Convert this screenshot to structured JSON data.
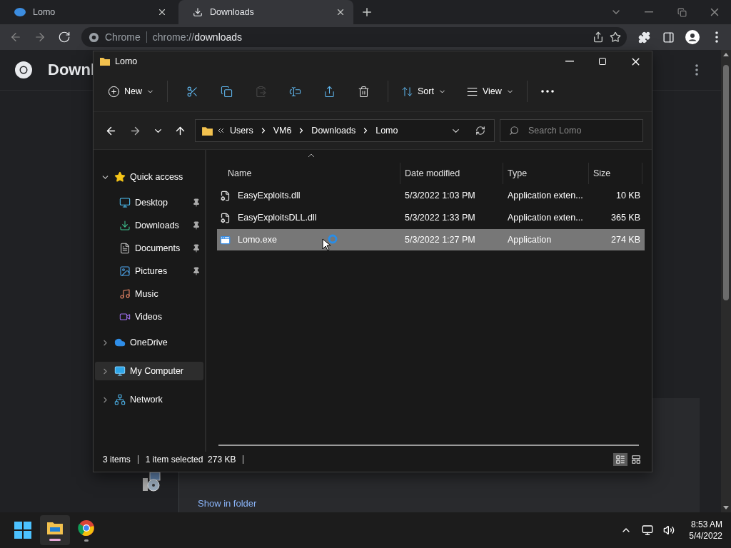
{
  "browser": {
    "tabs": [
      {
        "title": "Lomo",
        "kind": "site",
        "selected": false
      },
      {
        "title": "Downloads",
        "kind": "downloads",
        "selected": true
      }
    ],
    "omnibox": {
      "site": "Chrome",
      "url_prefix": "chrome://",
      "url_path": "downloads"
    }
  },
  "downloads_page": {
    "title": "Downl",
    "link": "Show in folder"
  },
  "explorer": {
    "title": "Lomo",
    "toolbar": {
      "new": "New",
      "sort": "Sort",
      "view": "View",
      "actions": [
        {
          "kind": "cut",
          "disabled": false
        },
        {
          "kind": "copy",
          "disabled": false
        },
        {
          "kind": "paste",
          "disabled": true
        },
        {
          "kind": "rename",
          "disabled": false
        },
        {
          "kind": "share",
          "disabled": false
        },
        {
          "kind": "delete",
          "disabled": false
        }
      ]
    },
    "breadcrumb": [
      "Users",
      "VM6",
      "Downloads",
      "Lomo"
    ],
    "search": {
      "placeholder": "Search Lomo"
    },
    "sidebar": [
      {
        "label": "Quick access",
        "kind": "star",
        "expanded": true,
        "selected": false,
        "children": [
          {
            "label": "Desktop",
            "kind": "desktop",
            "pinned": true,
            "selected": false
          },
          {
            "label": "Downloads",
            "kind": "downloads",
            "pinned": true,
            "selected": false
          },
          {
            "label": "Documents",
            "kind": "documents",
            "pinned": true,
            "selected": false
          },
          {
            "label": "Pictures",
            "kind": "pictures",
            "pinned": true,
            "selected": false
          },
          {
            "label": "Music",
            "kind": "music",
            "pinned": false,
            "selected": false
          },
          {
            "label": "Videos",
            "kind": "videos",
            "pinned": false,
            "selected": false
          }
        ]
      },
      {
        "label": "OneDrive",
        "kind": "cloud",
        "expanded": false,
        "selected": false
      },
      {
        "label": "My Computer",
        "kind": "computer",
        "expanded": false,
        "selected": true
      },
      {
        "label": "Network",
        "kind": "network",
        "expanded": false,
        "selected": false
      }
    ],
    "columns": [
      "Name",
      "Date modified",
      "Type",
      "Size"
    ],
    "rows": [
      {
        "name": "EasyExploits.dll",
        "kind": "dll",
        "date": "5/3/2022 1:03 PM",
        "type": "Application exten...",
        "size": "10 KB",
        "selected": false
      },
      {
        "name": "EasyExploitsDLL.dll",
        "kind": "dll",
        "date": "5/3/2022 1:33 PM",
        "type": "Application exten...",
        "size": "365 KB",
        "selected": false
      },
      {
        "name": "Lomo.exe",
        "kind": "exe",
        "date": "5/3/2022 1:27 PM",
        "type": "Application",
        "size": "274 KB",
        "selected": true
      }
    ],
    "status": {
      "count": "3 items",
      "selection": "1 item selected  273 KB"
    },
    "views": [
      {
        "kind": "details",
        "selected": true
      },
      {
        "kind": "tiles",
        "selected": false
      }
    ]
  },
  "taskbar": {
    "apps": [
      {
        "kind": "explorer",
        "selected": true
      },
      {
        "kind": "browser",
        "selected": false
      }
    ],
    "time": "8:53 AM",
    "date": "5/4/2022"
  }
}
